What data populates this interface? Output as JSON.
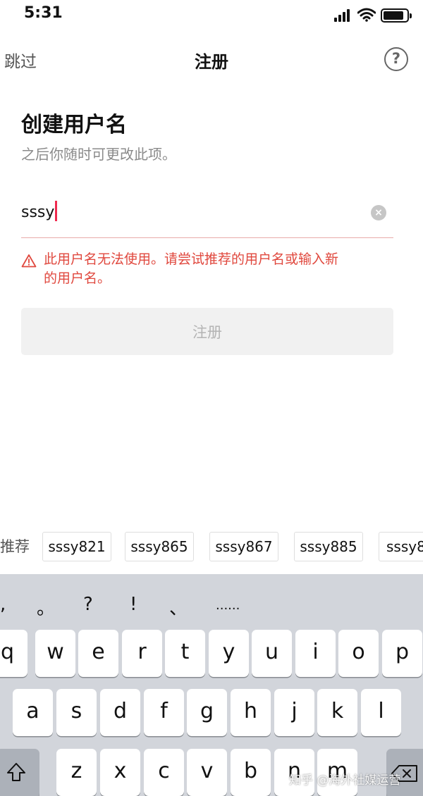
{
  "status_bar": {
    "time": "5:31"
  },
  "nav": {
    "skip_label": "跳过",
    "title": "注册",
    "help_symbol": "?"
  },
  "form": {
    "heading": "创建用户名",
    "subtext": "之后你随时可更改此项。",
    "username_value": "sssy",
    "clear_symbol": "×",
    "error_line1": "此用户名无法使用。请尝试推荐的用户名或输入新",
    "error_line2": "的用户名。",
    "submit_label": "注册"
  },
  "suggestions": {
    "label": "推荐",
    "chips": [
      "sssy821",
      "sssy865",
      "sssy867",
      "sssy885",
      "sssy8"
    ]
  },
  "keyboard": {
    "punct": [
      ",",
      "。",
      "?",
      "!",
      "、",
      "......"
    ],
    "row1": [
      "q",
      "w",
      "e",
      "r",
      "t",
      "y",
      "u",
      "i",
      "o",
      "p"
    ],
    "row2": [
      "a",
      "s",
      "d",
      "f",
      "g",
      "h",
      "j",
      "k",
      "l"
    ],
    "row3": [
      "z",
      "x",
      "c",
      "v",
      "b",
      "n",
      "m"
    ]
  },
  "watermark": "知乎 @海外社媒运营",
  "colors": {
    "error": "#e0483e",
    "caret": "#ef2a4f",
    "keyboard_bg": "#d2d5db",
    "disabled_button": "#f1f1f1"
  }
}
